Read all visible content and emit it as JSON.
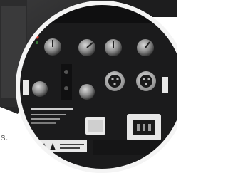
{
  "photo": {
    "subject": "speaker-amplifier-rear-panel",
    "colors": {
      "panel": "#1b1b1c",
      "ring": "#f4f4f4",
      "background_texture": "#2a2a2b",
      "accent_red": "#e23b2e"
    }
  },
  "caption": {
    "text": "s."
  }
}
